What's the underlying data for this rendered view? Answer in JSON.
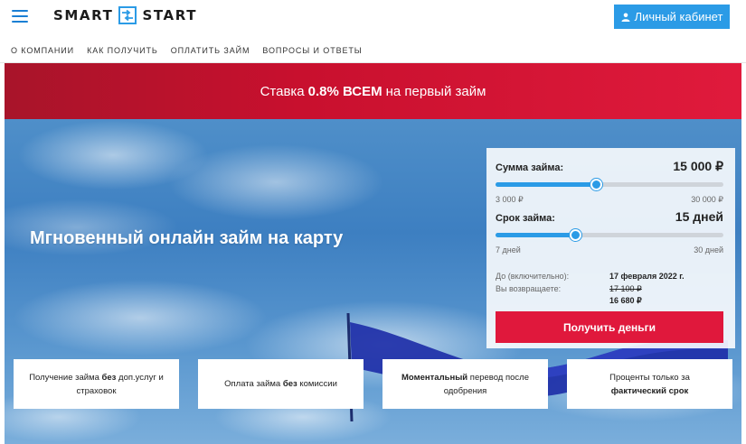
{
  "header": {
    "logo_left": "SMART",
    "logo_right": "START",
    "cabinet_label": "Личный кабинет",
    "accent": "#2b9be6",
    "icons": [
      "menu-icon",
      "user-icon"
    ]
  },
  "nav": {
    "items": [
      "О КОМПАНИИ",
      "КАК ПОЛУЧИТЬ",
      "ОПЛАТИТЬ ЗАЙМ",
      "ВОПРОСЫ И ОТВЕТЫ"
    ]
  },
  "promo": {
    "before": "Ставка",
    "highlight": "0.8% ВСЕМ",
    "after": "на первый займ",
    "color": "#c8102e"
  },
  "hero": {
    "title": "Мгновенный онлайн займ на карту"
  },
  "calculator": {
    "amount": {
      "label": "Сумма займа:",
      "value": "15 000 ₽",
      "min": "3 000 ₽",
      "max": "30 000 ₽",
      "fraction": 0.44
    },
    "term": {
      "label": "Срок займа:",
      "value": "15 дней",
      "min": "7 дней",
      "max": "30 дней",
      "fraction": 0.35
    },
    "due_label": "До (включительно):",
    "due_value": "17 февраля 2022 г.",
    "return_label": "Вы возвращаете:",
    "return_old": "17 100 ₽",
    "return_new": "16 680 ₽",
    "submit_label": "Получить деньги",
    "button_color": "#e0183c"
  },
  "features": [
    {
      "pre": "Получение займа",
      "bold": "без",
      "post": "доп.услуг и страховок",
      "bold_first": false
    },
    {
      "pre": "Оплата займа",
      "bold": "без",
      "post": "комиссии",
      "bold_first": false
    },
    {
      "pre": "",
      "bold": "Моментальный",
      "post": "перевод после одобрения",
      "bold_first": true
    },
    {
      "pre": "Проценты только за",
      "bold": "фактический срок",
      "post": "",
      "bold_first": false
    }
  ]
}
